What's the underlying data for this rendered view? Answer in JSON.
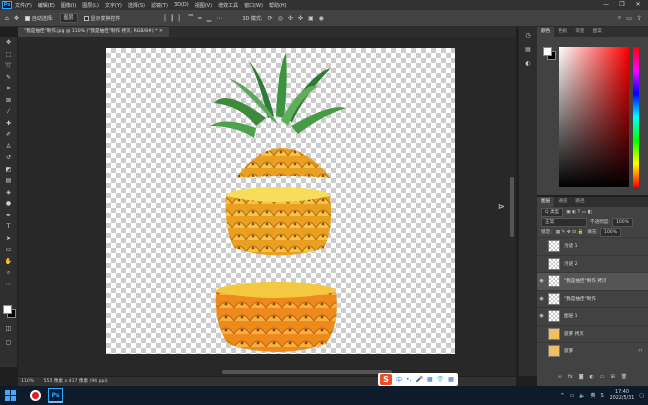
{
  "menubar": {
    "logo": "Ps",
    "items": [
      "文件(F)",
      "编辑(E)",
      "图像(I)",
      "图层(L)",
      "文字(Y)",
      "选择(S)",
      "滤镜(T)",
      "3D(D)",
      "视图(V)",
      "增效工具",
      "窗口(W)",
      "帮助(H)"
    ],
    "window_controls": [
      "—",
      "❐",
      "✕"
    ]
  },
  "options": {
    "auto_select_label": "自动选择:",
    "auto_select_value": "图层",
    "transform_label": "显示变换控件",
    "mode_label": "3D 模式:"
  },
  "document": {
    "tab_title": "\"我是抽佳\"制作.jpg @ 110% (\"我是抽佳\"制作 拷贝, RGB/8#) *  ✕"
  },
  "status": {
    "zoom": "110%",
    "doc_info": "555 像素 x 417 像素 (96 ppi)"
  },
  "ime": {
    "logo": "S",
    "icons": [
      "中",
      "•,",
      "🎤",
      "▦",
      "👕",
      "▦"
    ]
  },
  "color_panel": {
    "tabs": [
      "颜色",
      "色板",
      "渐变",
      "图案"
    ]
  },
  "layers_panel": {
    "tabs": [
      "图层",
      "通道",
      "路径"
    ],
    "filter": "Q 类型",
    "blend_mode": "正常",
    "opacity_label": "不透明度:",
    "opacity_value": "100%",
    "lock_label": "锁定:",
    "fill_label": "填充:",
    "fill_value": "100%",
    "layers": [
      {
        "name": "污迹 1",
        "visible": false,
        "selected": false
      },
      {
        "name": "污迹 2",
        "visible": false,
        "selected": false
      },
      {
        "name": "\"我是抽佳\"制作 拷贝",
        "visible": true,
        "selected": true
      },
      {
        "name": "\"我是抽佳\"制作",
        "visible": true,
        "selected": false
      },
      {
        "name": "图层 1",
        "visible": true,
        "selected": false
      },
      {
        "name": "菠萝 拷贝",
        "visible": false,
        "selected": false
      },
      {
        "name": "菠萝",
        "visible": false,
        "selected": false
      }
    ]
  },
  "taskbar": {
    "tray_up": "^",
    "keyboard": "英",
    "time": "17:40",
    "date": "2022/5/31"
  },
  "colors": {
    "accent": "#31a8ff",
    "selected_layer": "#555555",
    "fruit_yellow": "#f3b51f",
    "leaf_green": "#3e8a3a"
  }
}
